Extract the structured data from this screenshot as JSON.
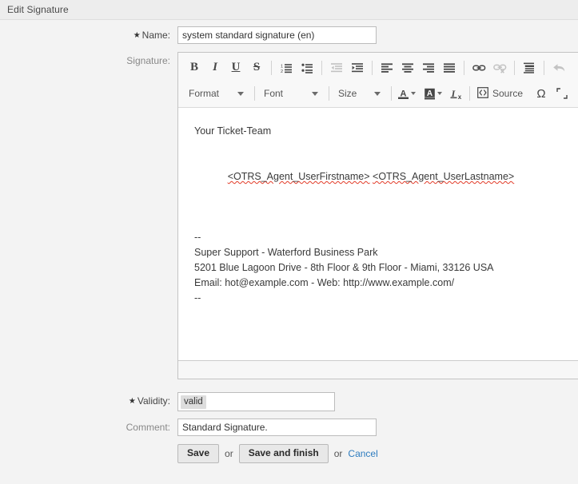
{
  "window": {
    "title": "Edit Signature"
  },
  "form": {
    "name": {
      "label": "Name:",
      "required_marker": "★",
      "value": "system standard signature (en)",
      "placeholder": ""
    },
    "signature": {
      "label": "Signature:"
    },
    "validity": {
      "label": "Validity:",
      "required_marker": "★",
      "selected": "valid"
    },
    "comment": {
      "label": "Comment:",
      "value": "Standard Signature.",
      "placeholder": ""
    }
  },
  "editor": {
    "toolbar_row1": [
      {
        "name": "bold-icon",
        "glyph": "B",
        "type": "text",
        "disabled": false
      },
      {
        "name": "italic-icon",
        "glyph": "I",
        "type": "text",
        "disabled": false
      },
      {
        "name": "underline-icon",
        "glyph": "U",
        "type": "text",
        "disabled": false
      },
      {
        "name": "strikethrough-icon",
        "glyph": "S",
        "type": "text",
        "disabled": false
      },
      {
        "name": "separator",
        "type": "sep"
      },
      {
        "name": "numbered-list-icon",
        "type": "svg-numlist",
        "disabled": false
      },
      {
        "name": "bulleted-list-icon",
        "type": "svg-bullist",
        "disabled": false
      },
      {
        "name": "separator",
        "type": "sep"
      },
      {
        "name": "decrease-indent-icon",
        "type": "svg-outdent",
        "disabled": true
      },
      {
        "name": "increase-indent-icon",
        "type": "svg-indent",
        "disabled": false
      },
      {
        "name": "separator",
        "type": "sep"
      },
      {
        "name": "align-left-icon",
        "type": "svg-alignleft",
        "disabled": false
      },
      {
        "name": "align-center-icon",
        "type": "svg-aligncenter",
        "disabled": false
      },
      {
        "name": "align-right-icon",
        "type": "svg-alignright",
        "disabled": false
      },
      {
        "name": "align-justify-icon",
        "type": "svg-alignjustify",
        "disabled": false
      },
      {
        "name": "separator",
        "type": "sep"
      },
      {
        "name": "link-icon",
        "type": "svg-link",
        "disabled": false
      },
      {
        "name": "unlink-icon",
        "type": "svg-unlink",
        "disabled": true
      },
      {
        "name": "separator",
        "type": "sep"
      },
      {
        "name": "blockquote-icon",
        "type": "svg-blockquote",
        "disabled": false
      },
      {
        "name": "separator",
        "type": "sep"
      },
      {
        "name": "undo-icon",
        "type": "svg-undo",
        "disabled": true
      }
    ],
    "toolbar_row2": {
      "format_label": "Format",
      "font_label": "Font",
      "size_label": "Size",
      "text_color_label": "A",
      "bg_color_label": "A",
      "remove_format_label": "I",
      "remove_format_sub": "x",
      "source_label": "Source",
      "omega_label": "Ω"
    },
    "content": {
      "greeting": "Your Ticket-Team",
      "tag_first": "<OTRS_Agent_UserFirstname>",
      "tag_last": "<OTRS_Agent_UserLastname>",
      "divider_top": "--",
      "company": "Super Support - Waterford Business Park",
      "address": "5201 Blue Lagoon Drive - 8th Floor & 9th Floor - Miami, 33126 USA",
      "contact": "Email: hot@example.com - Web: http://www.example.com/",
      "divider_bottom": "--"
    }
  },
  "actions": {
    "save_label": "Save",
    "or_label_1": "or",
    "save_and_finish_label": "Save and finish",
    "or_label_2": "or",
    "cancel_label": "Cancel"
  },
  "colors": {
    "header_bg": "#ededed",
    "page_bg": "#f3f3f3",
    "link": "#2f7dbf",
    "spellcheck_underline": "#e23b28",
    "token_bg": "#dddddd"
  }
}
